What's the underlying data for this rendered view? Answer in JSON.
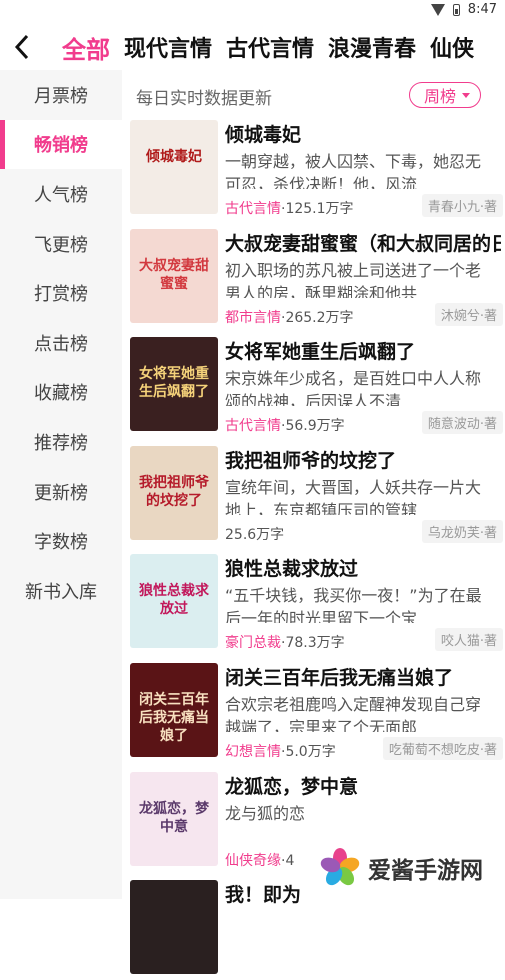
{
  "status": {
    "time": "8:47"
  },
  "nav": {
    "back_icon": "back-arrow-icon",
    "tabs": [
      {
        "label": "全部"
      },
      {
        "label": "现代言情"
      },
      {
        "label": "古代言情"
      },
      {
        "label": "浪漫青春"
      },
      {
        "label": "仙侠"
      }
    ]
  },
  "sidebar": {
    "items": [
      {
        "label": "月票榜"
      },
      {
        "label": "畅销榜"
      },
      {
        "label": "人气榜"
      },
      {
        "label": "飞更榜"
      },
      {
        "label": "打赏榜"
      },
      {
        "label": "点击榜"
      },
      {
        "label": "收藏榜"
      },
      {
        "label": "推荐榜"
      },
      {
        "label": "更新榜"
      },
      {
        "label": "字数榜"
      },
      {
        "label": "新书入库"
      }
    ]
  },
  "main": {
    "subtitle": "每日实时数据更新",
    "period": "周榜",
    "books": [
      {
        "title": "倾城毒妃",
        "desc": "一朝穿越，被人囚禁、下毒，她忍无可忍，杀伐决断！他，风流",
        "genre": "古代言情",
        "count": "·125.1万字",
        "author": "青春小九·著",
        "cover_text": "倾城毒妃",
        "cover_color": "#f3ece6",
        "cover_text_color": "#b01a1a"
      },
      {
        "title": "大叔宠妻甜蜜蜜（和大叔同居的日子）",
        "desc": "初入职场的苏凡被上司送进了一个老男人的房，酥里糊涂和他共",
        "genre": "都市言情",
        "count": "·265.2万字",
        "author": "沐婉兮·著",
        "cover_text": "大叔宠妻甜蜜蜜",
        "cover_color": "#f4d9d2",
        "cover_text_color": "#d2393f"
      },
      {
        "title": "女将军她重生后飒翻了",
        "desc": "宋京姝年少成名，是百姓口中人人称颂的战神，后因误人不清",
        "genre": "古代言情",
        "count": "·56.9万字",
        "author": "随意波动·著",
        "cover_text": "女将军她重生后飒翻了",
        "cover_color": "#3a2020",
        "cover_text_color": "#f5d27a"
      },
      {
        "title": "我把祖师爷的坟挖了",
        "desc": "宣统年间，大晋国，人妖共存一片大地上，东京都镇压司的管辖",
        "genre": "",
        "count": "25.6万字",
        "author": "乌龙奶芙·著",
        "cover_text": "我把祖师爷的坟挖了",
        "cover_color": "#e9d7c2",
        "cover_text_color": "#b51b2a"
      },
      {
        "title": "狼性总裁求放过",
        "desc": "“五千块钱，我买你一夜！”为了在最后一年的时光里留下一个宝",
        "genre": "豪门总裁",
        "count": "·78.3万字",
        "author": "咬人猫·著",
        "cover_text": "狼性总裁求放过",
        "cover_color": "#dbeef0",
        "cover_text_color": "#c2185b"
      },
      {
        "title": "闭关三百年后我无痛当娘了",
        "desc": "合欢宗老祖鹿鸣入定醒神发现自己穿越端了，宗里来了个无面郎",
        "genre": "幻想言情",
        "count": "·5.0万字",
        "author": "吃葡萄不想吃皮·著",
        "cover_text": "闭关三百年后我无痛当娘了",
        "cover_color": "#5a1416",
        "cover_text_color": "#f8e0c0"
      },
      {
        "title": "龙狐恋，梦中意",
        "desc": "龙与狐的恋",
        "genre": "仙侠奇缘",
        "count": "·4",
        "author": "",
        "cover_text": "龙狐恋，梦中意",
        "cover_color": "#f6e6ef",
        "cover_text_color": "#5b3a6b"
      },
      {
        "title": "我！即为",
        "desc": "",
        "genre": "",
        "count": "",
        "author": "",
        "cover_text": "",
        "cover_color": "#2a2020",
        "cover_text_color": "#ffffff"
      }
    ]
  },
  "watermark": {
    "text": "爱酱手游网"
  },
  "colors": {
    "accent": "#f13c8d"
  }
}
